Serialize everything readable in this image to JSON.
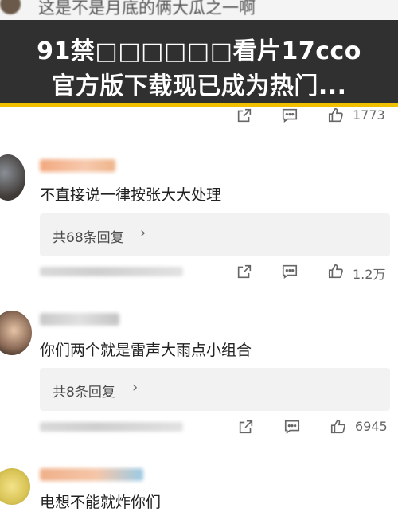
{
  "banner": {
    "line1": "91禁□□□□□□看片17cco",
    "line2": "官方版下载现已成为热门..."
  },
  "top_partial_text": "这是不是月底的俩大瓜之一啊",
  "action_rows": [
    {
      "like_count": "1773"
    },
    {
      "like_count": "1.2万"
    },
    {
      "like_count": "6945"
    }
  ],
  "comments": [
    {
      "text": "不直接说一律按张大大处理",
      "reply_label": "共68条回复"
    },
    {
      "text": "你们两个就是雷声大雨点小组合",
      "reply_label": "共8条回复"
    },
    {
      "text": "电想不能就炸你们"
    }
  ],
  "icons": [
    "share-icon",
    "comment-icon",
    "like-icon",
    "chevron-right-icon"
  ],
  "colors": {
    "banner_bg": "#303030",
    "banner_accent": "#f0c000",
    "reply_bg": "#f2f2f2"
  }
}
